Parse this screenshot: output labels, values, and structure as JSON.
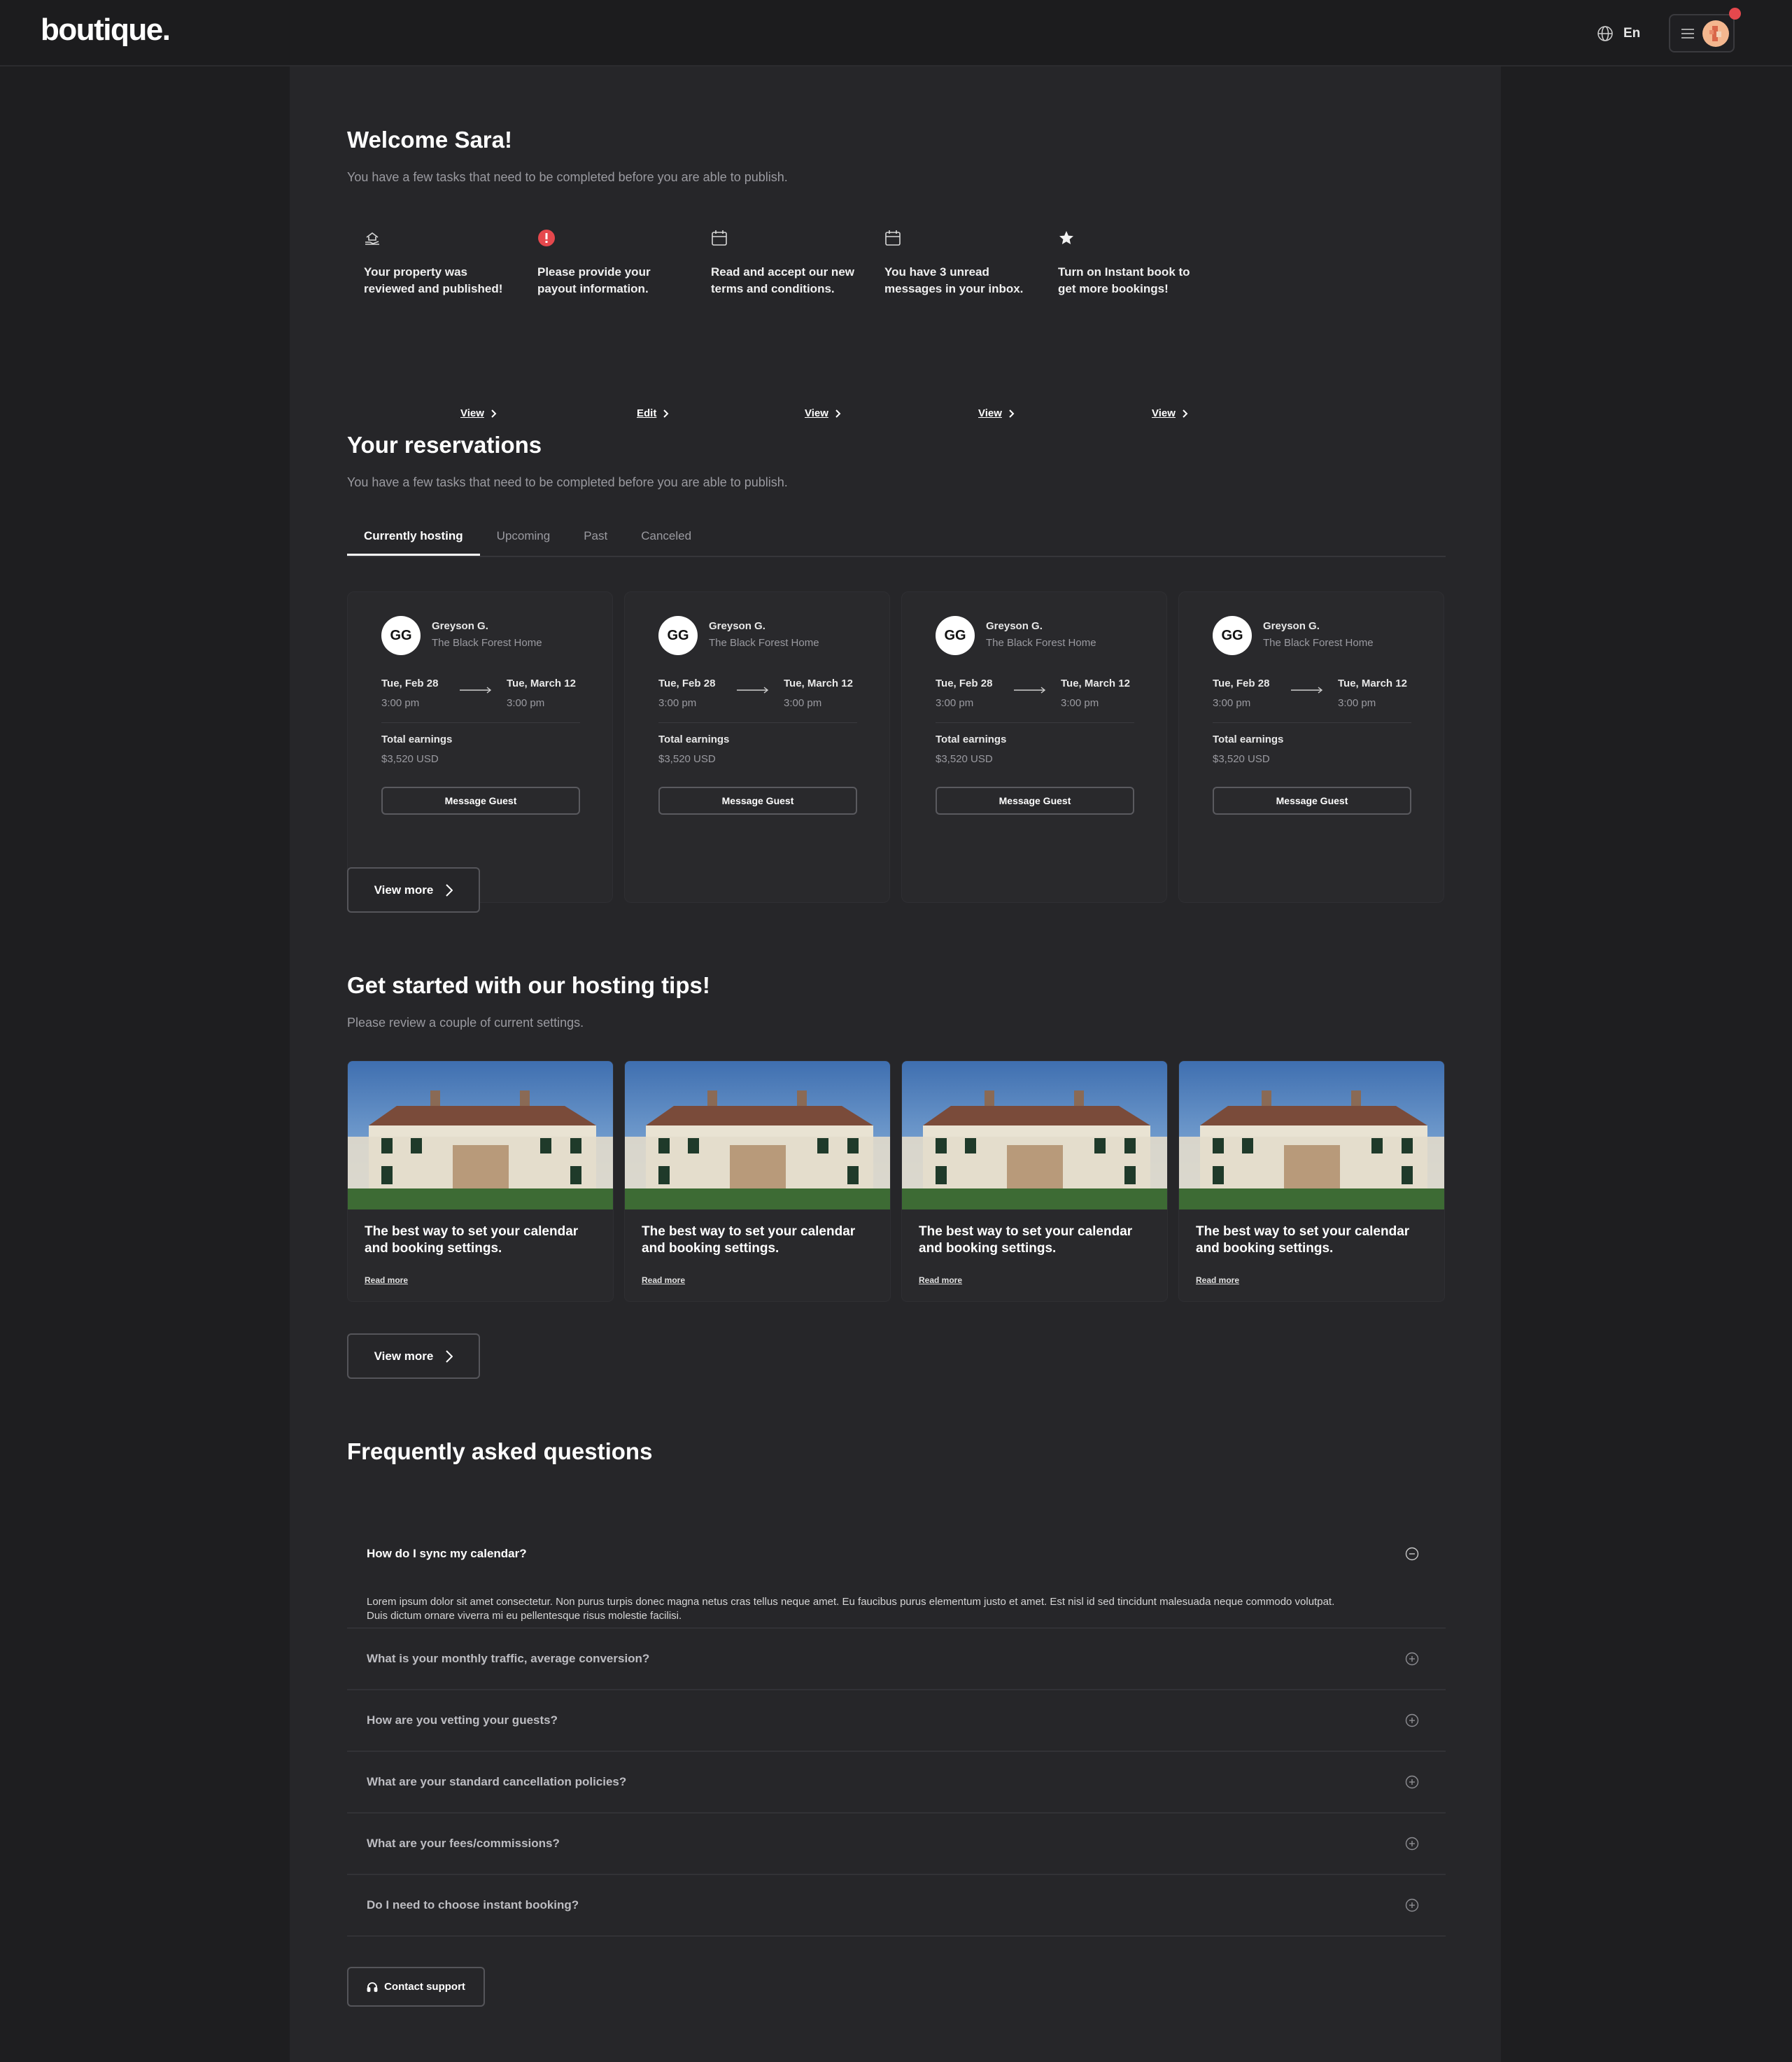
{
  "header": {
    "logo": "boutique.",
    "language": "En",
    "accent_notification": "#e5484d"
  },
  "welcome": {
    "title": "Welcome Sara!",
    "subtitle": "You have a few tasks that need to be completed before you are able to publish."
  },
  "tasks": [
    {
      "icon": "hand-house-icon",
      "text": "Your property was reviewed and published!",
      "link": "View"
    },
    {
      "icon": "alert-icon",
      "text": "Please provide your payout information.",
      "link": "Edit"
    },
    {
      "icon": "calendar-icon",
      "text": "Read and accept our new terms and conditions.",
      "link": "View"
    },
    {
      "icon": "calendar-icon",
      "text": "You have 3 unread messages in your inbox.",
      "link": "View"
    },
    {
      "icon": "star-icon",
      "text": "Turn on Instant book to get more bookings!",
      "link": "View"
    }
  ],
  "reservations": {
    "title": "Your  reservations",
    "subtitle": "You have a few tasks that need to be completed before you are able to publish.",
    "tabs": [
      "Currently hosting",
      "Upcoming",
      "Past",
      "Canceled"
    ],
    "active_tab": "Currently hosting",
    "cards": [
      {
        "initials": "GG",
        "guest": "Greyson G.",
        "property": "The Black Forest Home",
        "checkin_date": "Tue, Feb 28",
        "checkin_time": "3:00 pm",
        "checkout_date": "Tue, March 12",
        "checkout_time": "3:00 pm",
        "earnings_label": "Total earnings",
        "earnings": "$3,520 USD",
        "button": "Message Guest"
      },
      {
        "initials": "GG",
        "guest": "Greyson G.",
        "property": "The Black Forest Home",
        "checkin_date": "Tue, Feb 28",
        "checkin_time": "3:00 pm",
        "checkout_date": "Tue, March 12",
        "checkout_time": "3:00 pm",
        "earnings_label": "Total earnings",
        "earnings": "$3,520 USD",
        "button": "Message Guest"
      },
      {
        "initials": "GG",
        "guest": "Greyson G.",
        "property": "The Black Forest Home",
        "checkin_date": "Tue, Feb 28",
        "checkin_time": "3:00 pm",
        "checkout_date": "Tue, March 12",
        "checkout_time": "3:00 pm",
        "earnings_label": "Total earnings",
        "earnings": "$3,520 USD",
        "button": "Message Guest"
      },
      {
        "initials": "GG",
        "guest": "Greyson G.",
        "property": "The Black Forest Home",
        "checkin_date": "Tue, Feb 28",
        "checkin_time": "3:00 pm",
        "checkout_date": "Tue, March 12",
        "checkout_time": "3:00 pm",
        "earnings_label": "Total earnings",
        "earnings": "$3,520 USD",
        "button": "Message Guest"
      }
    ],
    "view_more": "View more"
  },
  "tips": {
    "title": "Get started with our hosting tips!",
    "subtitle": "Please review a couple of current settings.",
    "cards": [
      {
        "title": "The best way to set your calendar and booking settings.",
        "link": "Read more"
      },
      {
        "title": "The best way to set your calendar and booking settings.",
        "link": "Read more"
      },
      {
        "title": "The best way to set your calendar and booking settings.",
        "link": "Read more"
      },
      {
        "title": "The best way to set your calendar and booking settings.",
        "link": "Read more"
      }
    ],
    "view_more": "View more"
  },
  "faq": {
    "title": "Frequently asked questions",
    "items": [
      {
        "question": "How do I sync my calendar?",
        "answer": "Lorem ipsum dolor sit amet consectetur. Non purus turpis donec magna netus cras tellus neque amet. Eu faucibus purus elementum justo et amet. Est nisl id sed tincidunt malesuada neque commodo volutpat. Duis dictum ornare viverra mi eu pellentesque risus molestie facilisi.",
        "expanded": true
      },
      {
        "question": "What is your monthly traffic, average conversion?",
        "expanded": false
      },
      {
        "question": "How are you vetting your guests?",
        "expanded": false
      },
      {
        "question": "What are your standard cancellation policies?",
        "expanded": false
      },
      {
        "question": "What are your fees/commissions?",
        "expanded": false
      },
      {
        "question": "Do I need to choose instant booking?",
        "expanded": false
      }
    ],
    "support_button": "Contact support"
  }
}
